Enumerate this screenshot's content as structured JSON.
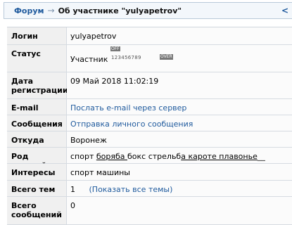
{
  "breadcrumb": {
    "forum": "Форум",
    "arrow": "→",
    "current": "Об участнике \"yulyapetrov\"",
    "edge": "<"
  },
  "profile": {
    "login": {
      "label": "Логин",
      "value": "yulyapetrov"
    },
    "status": {
      "label": "Статус",
      "value": "Участник",
      "rating_off": "OFF",
      "rating_scale": "123456789",
      "rating_over": "OVER"
    },
    "date": {
      "label": "Дата регистрации",
      "value": "09 Май 2018 11:02:19"
    },
    "email": {
      "label": "E-mail",
      "value": "Послать e-mail через сервер"
    },
    "message": {
      "label": "Сообщения",
      "value": "Отправка личного сообщения"
    },
    "from": {
      "label": "Откуда",
      "value": "Воронеж"
    },
    "job": {
      "label": "Род занятий",
      "w1": "спорт ",
      "w2": "боряба ",
      "w3": "бокс стрельб",
      "w4": "а кароте плавонье",
      "w5": "__"
    },
    "interests": {
      "label": "Интересы",
      "value": "спорт машины"
    },
    "total_topics": {
      "label": "Всего тем",
      "value": "1",
      "link": "(Показать все темы)"
    },
    "posts": {
      "label": "Всего сообщений",
      "value": "0"
    }
  },
  "colors": {
    "link": "#1f5a9d",
    "label_bg": "#f0f0f0",
    "border": "#d6dbe1"
  }
}
